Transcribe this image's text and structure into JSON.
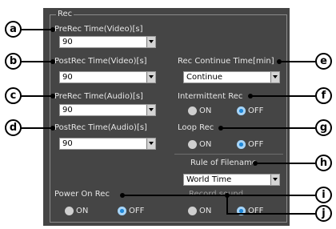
{
  "group": {
    "title": "Rec"
  },
  "fields": {
    "prerec_video": {
      "label": "PreRec Time(Video)[s]",
      "value": "90"
    },
    "postrec_video": {
      "label": "PostRec Time(Video)[s]",
      "value": "90"
    },
    "prerec_audio": {
      "label": "PreRec Time(Audio)[s]",
      "value": "90"
    },
    "postrec_audio": {
      "label": "PostRec Time(Audio)[s]",
      "value": "90"
    },
    "rec_continue": {
      "label": "Rec Continue Time[min]",
      "value": "Continue"
    },
    "rule_filename": {
      "label": "Rule of Filename",
      "value": "World Time"
    }
  },
  "radios": {
    "intermittent": {
      "label": "Intermittent Rec",
      "on": "ON",
      "off": "OFF",
      "selected": "OFF"
    },
    "loop": {
      "label": "Loop Rec",
      "on": "ON",
      "off": "OFF",
      "selected": "OFF"
    },
    "power_on": {
      "label": "Power On Rec",
      "on": "ON",
      "off": "OFF",
      "selected": "OFF"
    },
    "record_sound": {
      "label": "Record sound",
      "on": "ON",
      "off": "OFF",
      "selected": "OFF"
    }
  },
  "callouts": {
    "a": "a",
    "b": "b",
    "c": "c",
    "d": "d",
    "e": "e",
    "f": "f",
    "g": "g",
    "h": "h",
    "i": "i",
    "j": "j"
  }
}
